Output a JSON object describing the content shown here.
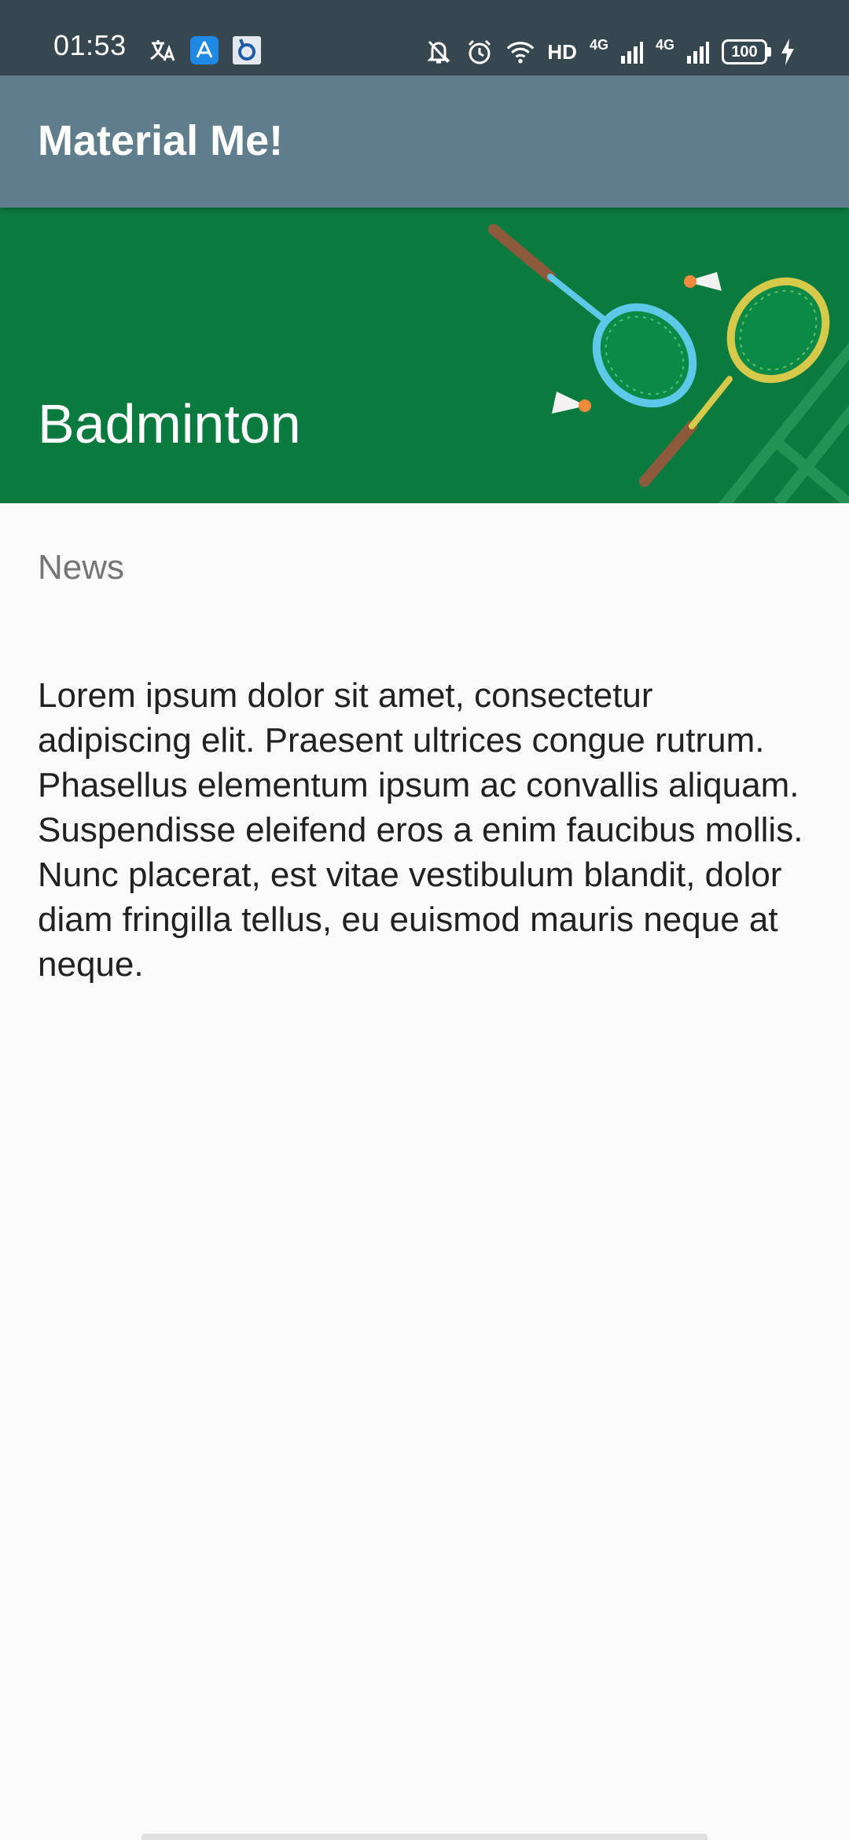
{
  "status_bar": {
    "time": "01:53",
    "hd_label": "HD",
    "net_label_1": "4G",
    "net_label_2": "4G",
    "battery": "100",
    "icons": [
      "translate-icon",
      "app-store-icon",
      "browser-icon",
      "mute-icon",
      "alarm-icon",
      "wifi-icon",
      "signal-icon",
      "signal-icon",
      "battery-icon",
      "charging-icon"
    ]
  },
  "app_bar": {
    "title": "Material Me!"
  },
  "detail": {
    "sport_title": "Badminton",
    "subtitle": "News",
    "body": "Lorem ipsum dolor sit amet, consectetur adipiscing elit. Praesent ultrices congue rutrum. Phasellus elementum ipsum ac convallis aliquam. Suspendisse eleifend eros a enim faucibus mollis. Nunc placerat, est vitae vestibulum blandit, dolor diam fringilla tellus, eu euismod mauris neque at neque.",
    "image_subject": "badminton rackets and shuttlecocks"
  },
  "colors": {
    "status_bar": "#37474f",
    "app_bar": "#607d8b",
    "header_green": "#0b7a3f",
    "background": "#fafafa",
    "body_text": "#212121",
    "subtitle_text": "#757575"
  }
}
